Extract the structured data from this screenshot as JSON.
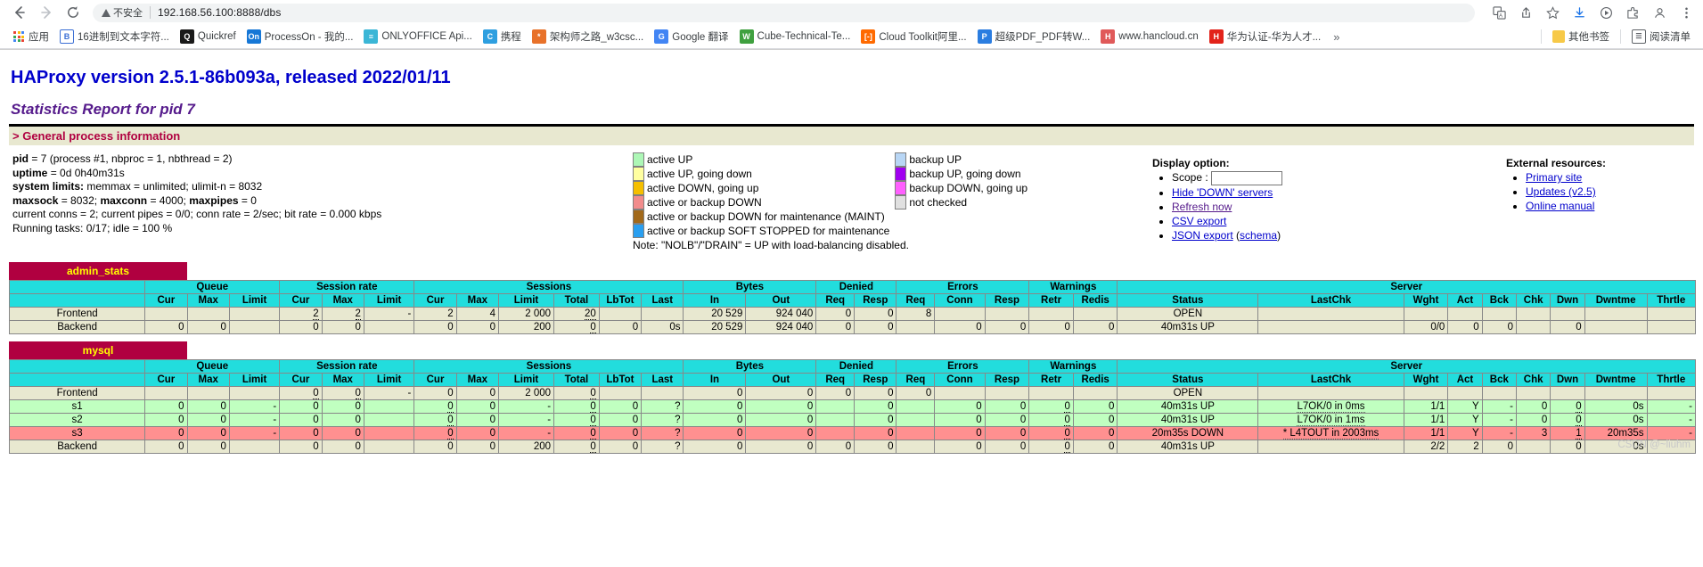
{
  "browser": {
    "back_icon": "back-arrow-icon",
    "forward_icon": "forward-arrow-icon",
    "reload_icon": "reload-icon",
    "security_label": "不安全",
    "url": "192.168.56.100:8888/dbs",
    "apps_label": "应用",
    "overflow_label": "»",
    "bookmarks": [
      {
        "label": "16进制到文本字符...",
        "glyph": "B",
        "color": "#3b6fd4",
        "bg": "#ffffff",
        "border": "#3b6fd4"
      },
      {
        "label": "Quickref",
        "glyph": "Q",
        "color": "#ffffff",
        "bg": "#1a1a1a",
        "border": "#1a1a1a"
      },
      {
        "label": "ProcessOn - 我的...",
        "glyph": "On",
        "color": "#ffffff",
        "bg": "#1677d6",
        "border": "#1677d6"
      },
      {
        "label": "ONLYOFFICE Api...",
        "glyph": "≡",
        "color": "#ffffff",
        "bg": "#3bb6d6",
        "border": "#3bb6d6"
      },
      {
        "label": "携程",
        "glyph": "C",
        "color": "#ffffff",
        "bg": "#2e9fe0",
        "border": "#2e9fe0"
      },
      {
        "label": "架构师之路_w3csc...",
        "glyph": "*",
        "color": "#ffffff",
        "bg": "#e8722a",
        "border": "#e8722a"
      },
      {
        "label": "Google 翻译",
        "glyph": "G",
        "color": "#ffffff",
        "bg": "#4285f4",
        "border": "#4285f4"
      },
      {
        "label": "Cube-Technical-Te...",
        "glyph": "W",
        "color": "#ffffff",
        "bg": "#3fa03f",
        "border": "#3fa03f"
      },
      {
        "label": "Cloud Toolkit阿里...",
        "glyph": "[-]",
        "color": "#ffffff",
        "bg": "#ff6a00",
        "border": "#ff6a00"
      },
      {
        "label": "超级PDF_PDF转W...",
        "glyph": "P",
        "color": "#ffffff",
        "bg": "#2b7de0",
        "border": "#2b7de0"
      },
      {
        "label": "www.hancloud.cn",
        "glyph": "H",
        "color": "#ffffff",
        "bg": "#e05a5a",
        "border": "#e05a5a"
      },
      {
        "label": "华为认证-华为人才...",
        "glyph": "H",
        "color": "#ffffff",
        "bg": "#e2231a",
        "border": "#e2231a"
      }
    ],
    "other_bookmarks_label": "其他书签",
    "reading_list_label": "阅读清单"
  },
  "haproxy": {
    "title": "HAProxy version 2.5.1-86b093a, released 2022/01/11",
    "subtitle": "Statistics Report for pid 7",
    "section_header": "> General process information",
    "process_info": {
      "pid_label": "pid",
      "pid_value": "= 7 (process #1, nbproc = 1, nbthread = 2)",
      "uptime_label": "uptime",
      "uptime_value": "= 0d 0h40m31s",
      "limits_label": "system limits:",
      "limits_value": "memmax = unlimited; ulimit-n = 8032",
      "maxsock_label": "maxsock",
      "maxsock_value": "= 8032;",
      "maxconn_label": "maxconn",
      "maxconn_value": "= 4000;",
      "maxpipes_label": "maxpipes",
      "maxpipes_value": "= 0",
      "current_line": "current conns = 2; current pipes = 0/0; conn rate = 2/sec; bit rate = 0.000 kbps",
      "tasks_line": "Running tasks: 0/17; idle = 100 %"
    },
    "legend": {
      "left": [
        {
          "color": "#adf7b6",
          "label": "active UP"
        },
        {
          "color": "#ffffa0",
          "label": "active UP, going down"
        },
        {
          "color": "#f5bf00",
          "label": "active DOWN, going up"
        },
        {
          "color": "#f28c8c",
          "label": "active or backup DOWN"
        },
        {
          "color": "#a2691a",
          "label": "active or backup DOWN for maintenance (MAINT)"
        },
        {
          "color": "#2a9ff0",
          "label": "active or backup SOFT STOPPED for maintenance"
        }
      ],
      "right": [
        {
          "color": "#b8d6f5",
          "label": "backup UP"
        },
        {
          "color": "#a000f0",
          "label": "backup UP, going down"
        },
        {
          "color": "#ff60ff",
          "label": "backup DOWN, going up"
        },
        {
          "color": "#e0e0e0",
          "label": "not checked"
        }
      ],
      "note": "Note: \"NOLB\"/\"DRAIN\" = UP with load-balancing disabled."
    },
    "display_option": {
      "title": "Display option:",
      "scope_label": "Scope :",
      "scope_value": "",
      "scope_placeholder": "",
      "links": [
        "Hide 'DOWN' servers",
        "Refresh now",
        "CSV export"
      ],
      "json_export": "JSON export",
      "json_schema": "schema"
    },
    "external_resources": {
      "title": "External resources:",
      "links": [
        "Primary site",
        "Updates (v2.5)",
        "Online manual"
      ]
    },
    "col_groups": [
      "",
      "Queue",
      "Session rate",
      "Sessions",
      "Bytes",
      "Denied",
      "Errors",
      "Warnings",
      "Server"
    ],
    "col_headers": [
      "",
      "Cur",
      "Max",
      "Limit",
      "Cur",
      "Max",
      "Limit",
      "Cur",
      "Max",
      "Limit",
      "Total",
      "LbTot",
      "Last",
      "In",
      "Out",
      "Req",
      "Resp",
      "Req",
      "Conn",
      "Resp",
      "Retr",
      "Redis",
      "Status",
      "LastChk",
      "Wght",
      "Act",
      "Bck",
      "Chk",
      "Dwn",
      "Dwntme",
      "Thrtle"
    ],
    "proxies": [
      {
        "name": "admin_stats",
        "rows": [
          {
            "kind": "frontend",
            "name": "Frontend",
            "cells": [
              "",
              "",
              "",
              "2",
              "2",
              "-",
              "2",
              "4",
              "2 000",
              "20",
              "",
              "",
              "20 529",
              "924 040",
              "0",
              "0",
              "8",
              "",
              "",
              "",
              "",
              "OPEN",
              "",
              "",
              "",
              "",
              "",
              "",
              "",
              ""
            ],
            "underline": [
              3,
              4,
              9
            ]
          },
          {
            "kind": "backend",
            "name": "Backend",
            "cells": [
              "0",
              "0",
              "",
              "0",
              "0",
              "",
              "0",
              "0",
              "200",
              "0",
              "0",
              "0s",
              "20 529",
              "924 040",
              "0",
              "0",
              "",
              "0",
              "0",
              "0",
              "0",
              "40m31s UP",
              "",
              "0/0",
              "0",
              "0",
              "",
              "0",
              "",
              ""
            ],
            "underline": [
              9
            ]
          }
        ]
      },
      {
        "name": "mysql",
        "rows": [
          {
            "kind": "frontend",
            "name": "Frontend",
            "cells": [
              "",
              "",
              "",
              "0",
              "0",
              "-",
              "0",
              "0",
              "2 000",
              "0",
              "",
              "",
              "0",
              "0",
              "0",
              "0",
              "0",
              "",
              "",
              "",
              "",
              "OPEN",
              "",
              "",
              "",
              "",
              "",
              "",
              "",
              ""
            ],
            "underline": [
              3,
              4,
              9
            ]
          },
          {
            "kind": "up",
            "name": "s1",
            "cells": [
              "0",
              "0",
              "-",
              "0",
              "0",
              "",
              "0",
              "0",
              "-",
              "0",
              "0",
              "?",
              "0",
              "0",
              "",
              "0",
              "",
              "0",
              "0",
              "0",
              "0",
              "40m31s UP",
              "L7OK/0 in 0ms",
              "1/1",
              "Y",
              "-",
              "0",
              "0",
              "0s",
              "-"
            ],
            "underline": [
              6,
              9,
              19,
              27
            ]
          },
          {
            "kind": "up",
            "name": "s2",
            "cells": [
              "0",
              "0",
              "-",
              "0",
              "0",
              "",
              "0",
              "0",
              "-",
              "0",
              "0",
              "?",
              "0",
              "0",
              "",
              "0",
              "",
              "0",
              "0",
              "0",
              "0",
              "40m31s UP",
              "L7OK/0 in 1ms",
              "1/1",
              "Y",
              "-",
              "0",
              "0",
              "0s",
              "-"
            ],
            "underline": [
              6,
              9,
              19,
              27
            ]
          },
          {
            "kind": "down",
            "name": "s3",
            "cells": [
              "0",
              "0",
              "-",
              "0",
              "0",
              "",
              "0",
              "0",
              "-",
              "0",
              "0",
              "?",
              "0",
              "0",
              "",
              "0",
              "",
              "0",
              "0",
              "0",
              "0",
              "20m35s DOWN",
              "* L4TOUT in 2003ms",
              "1/1",
              "Y",
              "-",
              "3",
              "1",
              "20m35s",
              "-"
            ],
            "underline": [
              6,
              9,
              19,
              27
            ]
          },
          {
            "kind": "backend",
            "name": "Backend",
            "cells": [
              "0",
              "0",
              "",
              "0",
              "0",
              "",
              "0",
              "0",
              "200",
              "0",
              "0",
              "?",
              "0",
              "0",
              "0",
              "0",
              "",
              "0",
              "0",
              "0",
              "0",
              "40m31s UP",
              "",
              "2/2",
              "2",
              "0",
              "",
              "0",
              "0s",
              ""
            ],
            "underline": [
              9,
              19
            ]
          }
        ]
      }
    ]
  },
  "watermark": "CSDN @~liuhm"
}
